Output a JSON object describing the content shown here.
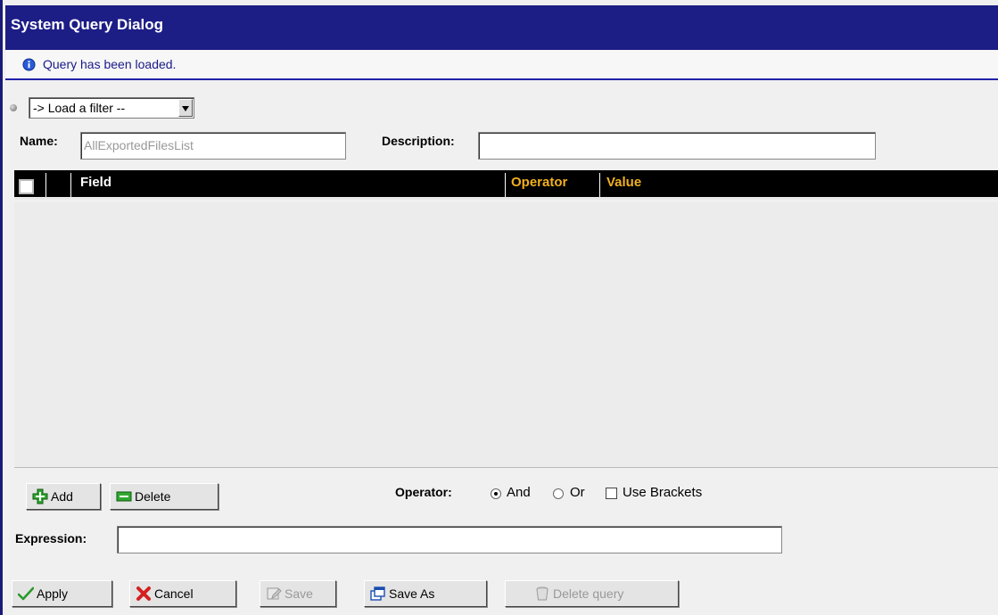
{
  "dialog": {
    "title": "System Query Dialog",
    "status_message": "Query has been loaded."
  },
  "filter": {
    "select_value": "-> Load a filter --"
  },
  "form": {
    "name_label": "Name:",
    "name_value": "AllExportedFilesList",
    "description_label": "Description:",
    "description_value": ""
  },
  "grid": {
    "columns": {
      "field": "Field",
      "operator": "Operator",
      "value": "Value"
    },
    "rows": []
  },
  "row_actions": {
    "add_label": "Add",
    "delete_label": "Delete"
  },
  "operator": {
    "label": "Operator:",
    "and_label": "And",
    "or_label": "Or",
    "brackets_label": "Use Brackets",
    "selected": "And",
    "use_brackets": false
  },
  "expression": {
    "label": "Expression:",
    "value": ""
  },
  "footer": {
    "apply_label": "Apply",
    "cancel_label": "Cancel",
    "save_label": "Save",
    "save_as_label": "Save As",
    "delete_query_label": "Delete query"
  },
  "colors": {
    "title_bar": "#1d1d86",
    "header_bg": "#000000",
    "header_accent": "#f0b020"
  },
  "icons": [
    "info-icon",
    "chevron-down-icon",
    "add-icon",
    "delete-icon",
    "check-icon",
    "cancel-icon",
    "save-icon",
    "save-as-icon",
    "trash-icon"
  ]
}
